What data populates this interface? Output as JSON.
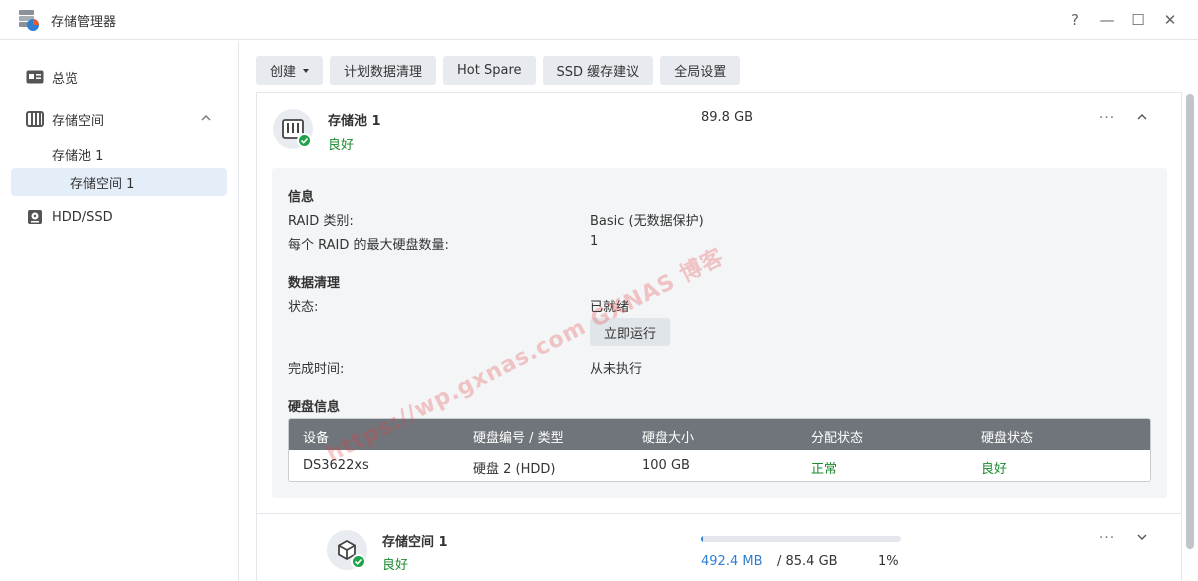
{
  "window": {
    "title": "存储管理器",
    "help_label": "?",
    "minimize_label": "—",
    "maximize_label": "☐",
    "close_label": "✕"
  },
  "sidebar": {
    "items": [
      {
        "label": "总览",
        "icon": "overview-icon"
      },
      {
        "label": "存储空间",
        "icon": "storage-icon"
      },
      {
        "label": "存储池 1"
      },
      {
        "label": "存储空间 1"
      },
      {
        "label": "HDD/SSD",
        "icon": "disk-icon"
      }
    ]
  },
  "toolbar": {
    "create_label": "创建",
    "scrub_label": "计划数据清理",
    "hotspare_label": "Hot Spare",
    "ssd_cache_label": "SSD 缓存建议",
    "global_settings_label": "全局设置"
  },
  "pool": {
    "name": "存储池 1",
    "status": "良好",
    "size": "89.8 GB",
    "info_title": "信息",
    "raid_type_label": "RAID 类别:",
    "raid_type_value": "Basic (无数据保护)",
    "max_disks_label": "每个 RAID 的最大硬盘数量:",
    "max_disks_value": "1",
    "scrub_title": "数据清理",
    "scrub_status_label": "状态:",
    "scrub_status_value": "已就绪",
    "run_now_label": "立即运行",
    "completed_label": "完成时间:",
    "completed_value": "从未执行",
    "disk_info_title": "硬盘信息",
    "disk_table": {
      "headers": [
        "设备",
        "硬盘编号 / 类型",
        "硬盘大小",
        "分配状态",
        "硬盘状态"
      ],
      "rows": [
        [
          "DS3622xs",
          "硬盘 2 (HDD)",
          "100 GB",
          "正常",
          "良好"
        ]
      ]
    }
  },
  "volume": {
    "name": "存储空间 1",
    "status": "良好",
    "used": "492.4 MB",
    "total_sep": "/ 85.4 GB",
    "percent_label": "1%",
    "usage_fraction": 0.01
  },
  "more_label": "···",
  "watermark": "https://wp.gxnas.com  GXNAS 博客",
  "colors": {
    "ok_green": "#1a8a2e",
    "accent_blue": "#2f7fd0",
    "table_header": "#6f757b",
    "sidebar_active": "#e4eef9"
  }
}
